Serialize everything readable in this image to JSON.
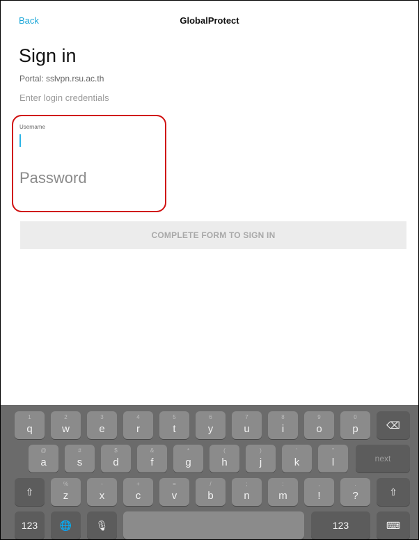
{
  "header": {
    "back_label": "Back",
    "title": "GlobalProtect"
  },
  "form": {
    "heading": "Sign in",
    "portal_text": "Portal: sslvpn.rsu.ac.th",
    "instructions": "Enter login credentials",
    "username_label": "Username",
    "username_value": "",
    "password_placeholder": "Password",
    "submit_label": "COMPLETE FORM TO SIGN IN"
  },
  "colors": {
    "accent": "#1aa6d8",
    "highlight": "#d01010",
    "keyboard_bg": "#6b6b6b"
  },
  "keyboard": {
    "row1": [
      {
        "key": "q",
        "hint": "1"
      },
      {
        "key": "w",
        "hint": "2"
      },
      {
        "key": "e",
        "hint": "3"
      },
      {
        "key": "r",
        "hint": "4"
      },
      {
        "key": "t",
        "hint": "5"
      },
      {
        "key": "y",
        "hint": "6"
      },
      {
        "key": "u",
        "hint": "7"
      },
      {
        "key": "i",
        "hint": "8"
      },
      {
        "key": "o",
        "hint": "9"
      },
      {
        "key": "p",
        "hint": "0"
      }
    ],
    "backspace_icon": "⌫",
    "row2": [
      {
        "key": "a",
        "hint": "@"
      },
      {
        "key": "s",
        "hint": "#"
      },
      {
        "key": "d",
        "hint": "$"
      },
      {
        "key": "f",
        "hint": "&"
      },
      {
        "key": "g",
        "hint": "*"
      },
      {
        "key": "h",
        "hint": "("
      },
      {
        "key": "j",
        "hint": ")"
      },
      {
        "key": "k",
        "hint": "'"
      },
      {
        "key": "l",
        "hint": "\""
      }
    ],
    "next_label": "next",
    "shift_icon": "⇧",
    "row3": [
      {
        "key": "z",
        "hint": "%"
      },
      {
        "key": "x",
        "hint": "-"
      },
      {
        "key": "c",
        "hint": "+"
      },
      {
        "key": "v",
        "hint": "="
      },
      {
        "key": "b",
        "hint": "/"
      },
      {
        "key": "n",
        "hint": ";"
      },
      {
        "key": "m",
        "hint": ":"
      },
      {
        "key": "!",
        "hint": ","
      },
      {
        "key": "?",
        "hint": "."
      }
    ],
    "numbers_label": "123",
    "globe_icon": "🌐",
    "mic_icon": "🎙",
    "keyboard_icon": "⌨"
  }
}
